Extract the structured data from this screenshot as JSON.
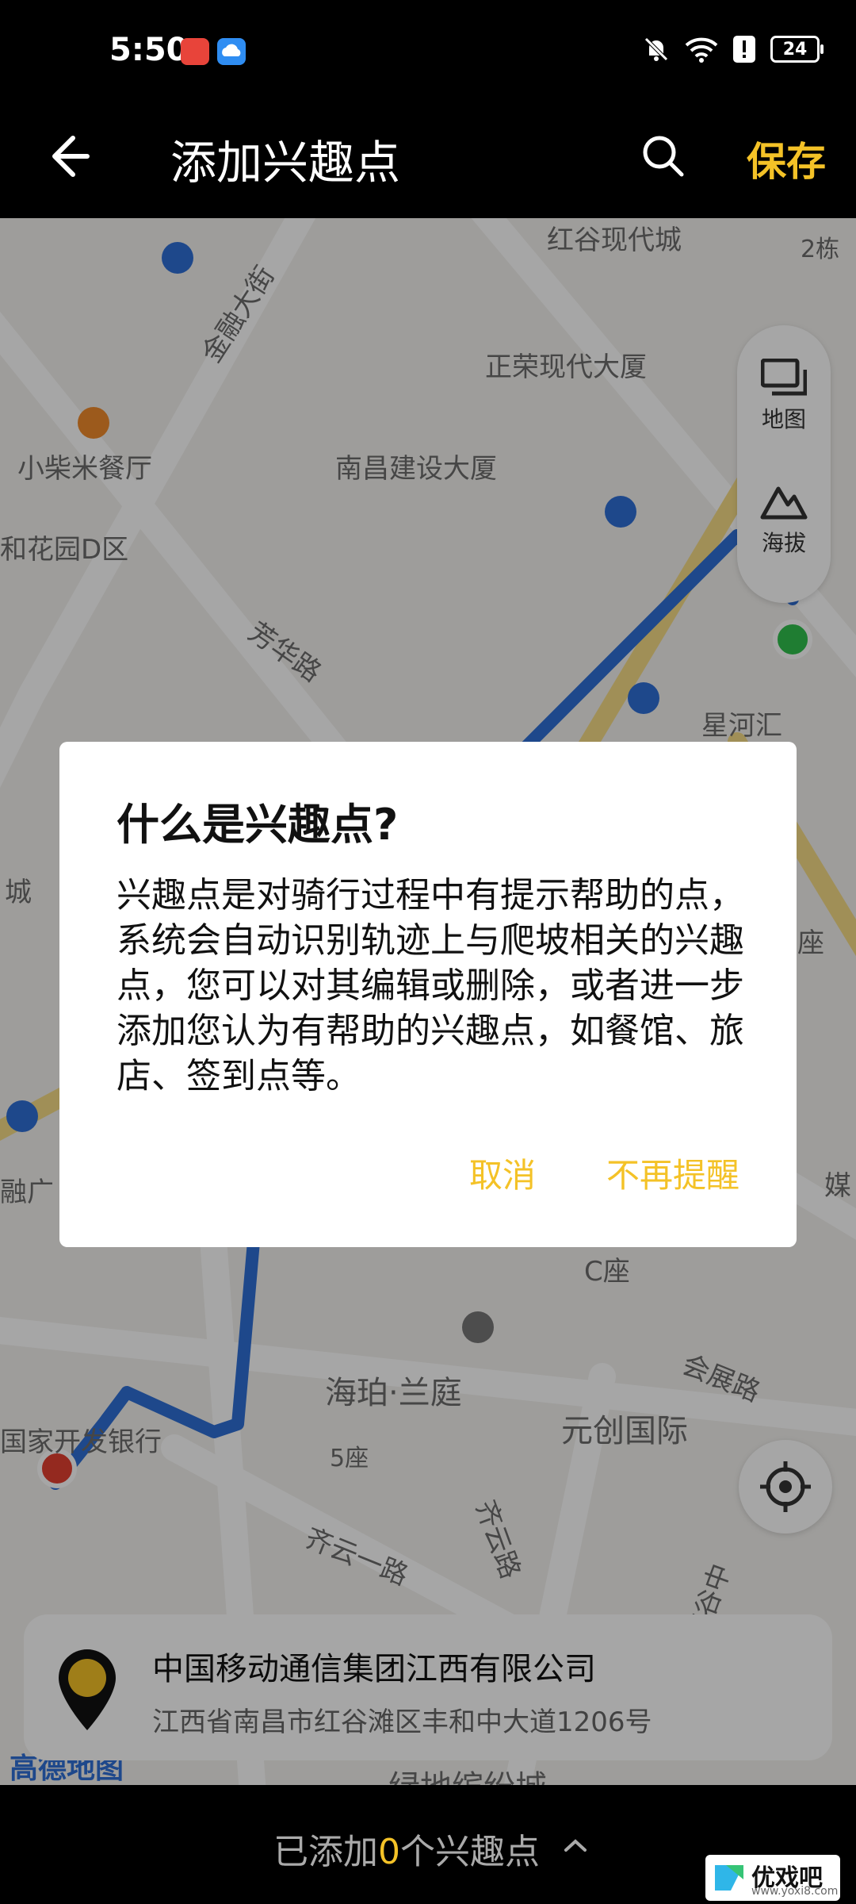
{
  "status_bar": {
    "time": "5:50",
    "battery": "24"
  },
  "header": {
    "title": "添加兴趣点",
    "save_label": "保存"
  },
  "map": {
    "labels": [
      "红谷现代城",
      "2栋",
      "金融大街",
      "正荣现代大厦",
      "小柴米餐厅",
      "南昌建设大厦",
      "和花园D区",
      "芳华路",
      "星河汇",
      "城",
      "座",
      "C座",
      "海珀·兰庭",
      "会展路",
      "元创国际",
      "国家开发银行",
      "5座",
      "齐云一路",
      "齐云路",
      "红谷中",
      "绿地缤纷城",
      "融广",
      "媒"
    ],
    "tools": [
      {
        "label": "地图",
        "icon": "map-layers-icon"
      },
      {
        "label": "海拔",
        "icon": "mountain-icon"
      }
    ],
    "provider": "高德地图"
  },
  "place_card": {
    "name": "中国移动通信集团江西有限公司",
    "address": "江西省南昌市红谷滩区丰和中大道1206号"
  },
  "bottom_bar": {
    "prefix": "已添加",
    "count": "0",
    "suffix": "个兴趣点"
  },
  "dialog": {
    "title": "什么是兴趣点?",
    "body": "兴趣点是对骑行过程中有提示帮助的点，系统会自动识别轨迹上与爬坡相关的兴趣点，您可以对其编辑或删除，或者进一步添加您认为有帮助的兴趣点，如餐馆、旅店、签到点等。",
    "cancel_label": "取消",
    "dont_remind_label": "不再提醒"
  },
  "watermark": {
    "text": "优戏吧",
    "url": "www.yoxi8.com"
  },
  "colors": {
    "accent": "#f4c227",
    "route": "#2f6fd6"
  }
}
